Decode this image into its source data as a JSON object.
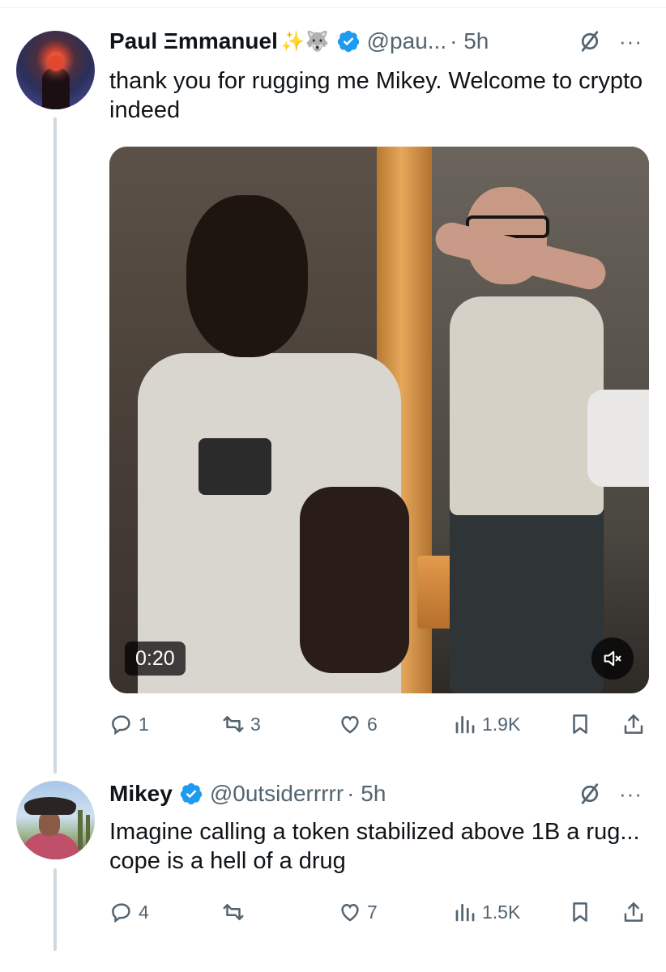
{
  "tweets": [
    {
      "author_name": "Paul Ξmmanuel",
      "author_emojis": "✨🐺",
      "handle": "@pau...",
      "time": "· 5h",
      "more": "···",
      "text": "thank you for rugging me Mikey. Welcome to crypto indeed",
      "media": {
        "duration": "0:20",
        "muted": true
      },
      "stats": {
        "replies": "1",
        "reposts": "3",
        "likes": "6",
        "views": "1.9K"
      }
    },
    {
      "author_name": "Mikey",
      "handle": "@0utsiderrrrr",
      "time": "· 5h",
      "more": "···",
      "text": "Imagine calling a token stabilized above 1B a rug... cope is a hell of a drug",
      "stats": {
        "replies": "4",
        "reposts": "",
        "likes": "7",
        "views": "1.5K"
      }
    }
  ],
  "colors": {
    "verified": "#1d9bf0",
    "muted_text": "#536471",
    "thread_line": "#cfd9de"
  },
  "icons": [
    "verified-badge-icon",
    "grok-icon",
    "more-icon",
    "reply-icon",
    "repost-icon",
    "like-icon",
    "views-icon",
    "bookmark-icon",
    "share-icon",
    "mute-icon"
  ]
}
